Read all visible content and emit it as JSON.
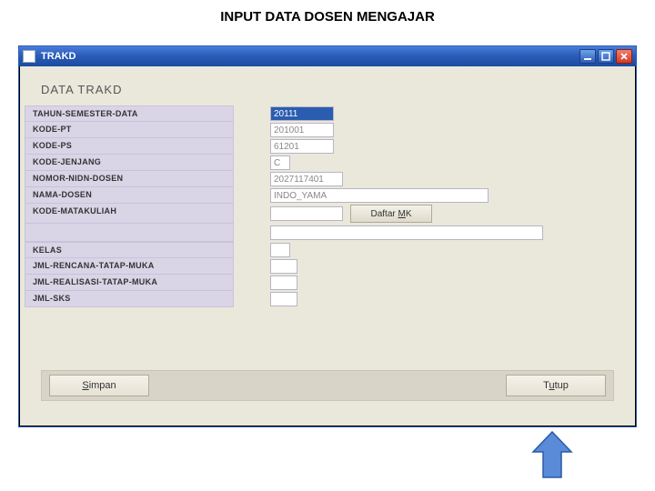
{
  "page_heading": "INPUT DATA DOSEN MENGAJAR",
  "window": {
    "title": "TRAKD",
    "section_title": "DATA TRAKD"
  },
  "labels": {
    "tahun_semester": "TAHUN-SEMESTER-DATA",
    "kode_pt": "KODE-PT",
    "kode_ps": "KODE-PS",
    "kode_jenjang": "KODE-JENJANG",
    "nomor_nidn": "NOMOR-NIDN-DOSEN",
    "nama_dosen": "NAMA-DOSEN",
    "kode_mk": "KODE-MATAKULIAH",
    "kelas": "KELAS",
    "jml_rencana": "JML-RENCANA-TATAP-MUKA",
    "jml_realisasi": "JML-REALISASI-TATAP-MUKA",
    "jml_sks": "JML-SKS"
  },
  "values": {
    "tahun_semester": "20111",
    "kode_pt": "201001",
    "kode_ps": "61201",
    "kode_jenjang": "C",
    "nomor_nidn": "2027117401",
    "nama_dosen": "INDO_YAMA",
    "kode_mk": "",
    "mk_desc": "",
    "kelas": "",
    "jml_rencana": "",
    "jml_realisasi": "",
    "jml_sks": ""
  },
  "buttons": {
    "daftar_mk_prefix": "Daftar ",
    "daftar_mk_ul": "M",
    "daftar_mk_suffix": "K",
    "simpan_ul": "S",
    "simpan_suffix": "impan",
    "tutup_prefix": "T",
    "tutup_ul": "u",
    "tutup_suffix": "tup"
  }
}
